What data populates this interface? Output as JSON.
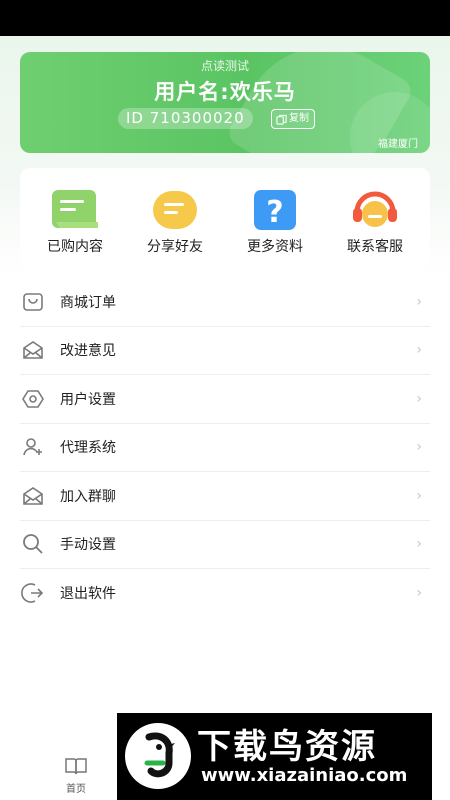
{
  "profile": {
    "subtitle": "点读测试",
    "username": "用户名:欢乐马",
    "id_text": "ID 710300020",
    "copy_label": "复制",
    "location": "福建厦门"
  },
  "quick_actions": [
    {
      "label": "已购内容",
      "icon": "purchased-content-icon",
      "color": "#8fd36a"
    },
    {
      "label": "分享好友",
      "icon": "share-chat-icon",
      "color": "#f7c94b"
    },
    {
      "label": "更多资料",
      "icon": "question-icon",
      "color": "#3d9bf5"
    },
    {
      "label": "联系客服",
      "icon": "headset-icon",
      "color": "#f15a3c"
    }
  ],
  "menu": [
    {
      "label": "商城订单",
      "icon": "shopping-bag-icon"
    },
    {
      "label": "改进意见",
      "icon": "mail-icon"
    },
    {
      "label": "用户设置",
      "icon": "hexagon-settings-icon"
    },
    {
      "label": "代理系统",
      "icon": "add-user-icon"
    },
    {
      "label": "加入群聊",
      "icon": "mail-icon"
    },
    {
      "label": "手动设置",
      "icon": "search-icon"
    },
    {
      "label": "退出软件",
      "icon": "logout-icon"
    }
  ],
  "chevron": "›",
  "tabbar": {
    "home_label": "首页"
  },
  "watermark": {
    "title": "下载鸟资源",
    "url": "www.xiazainiao.com"
  },
  "colors": {
    "card_green": "#5ac463",
    "icon_gray": "#7a7a7a"
  }
}
